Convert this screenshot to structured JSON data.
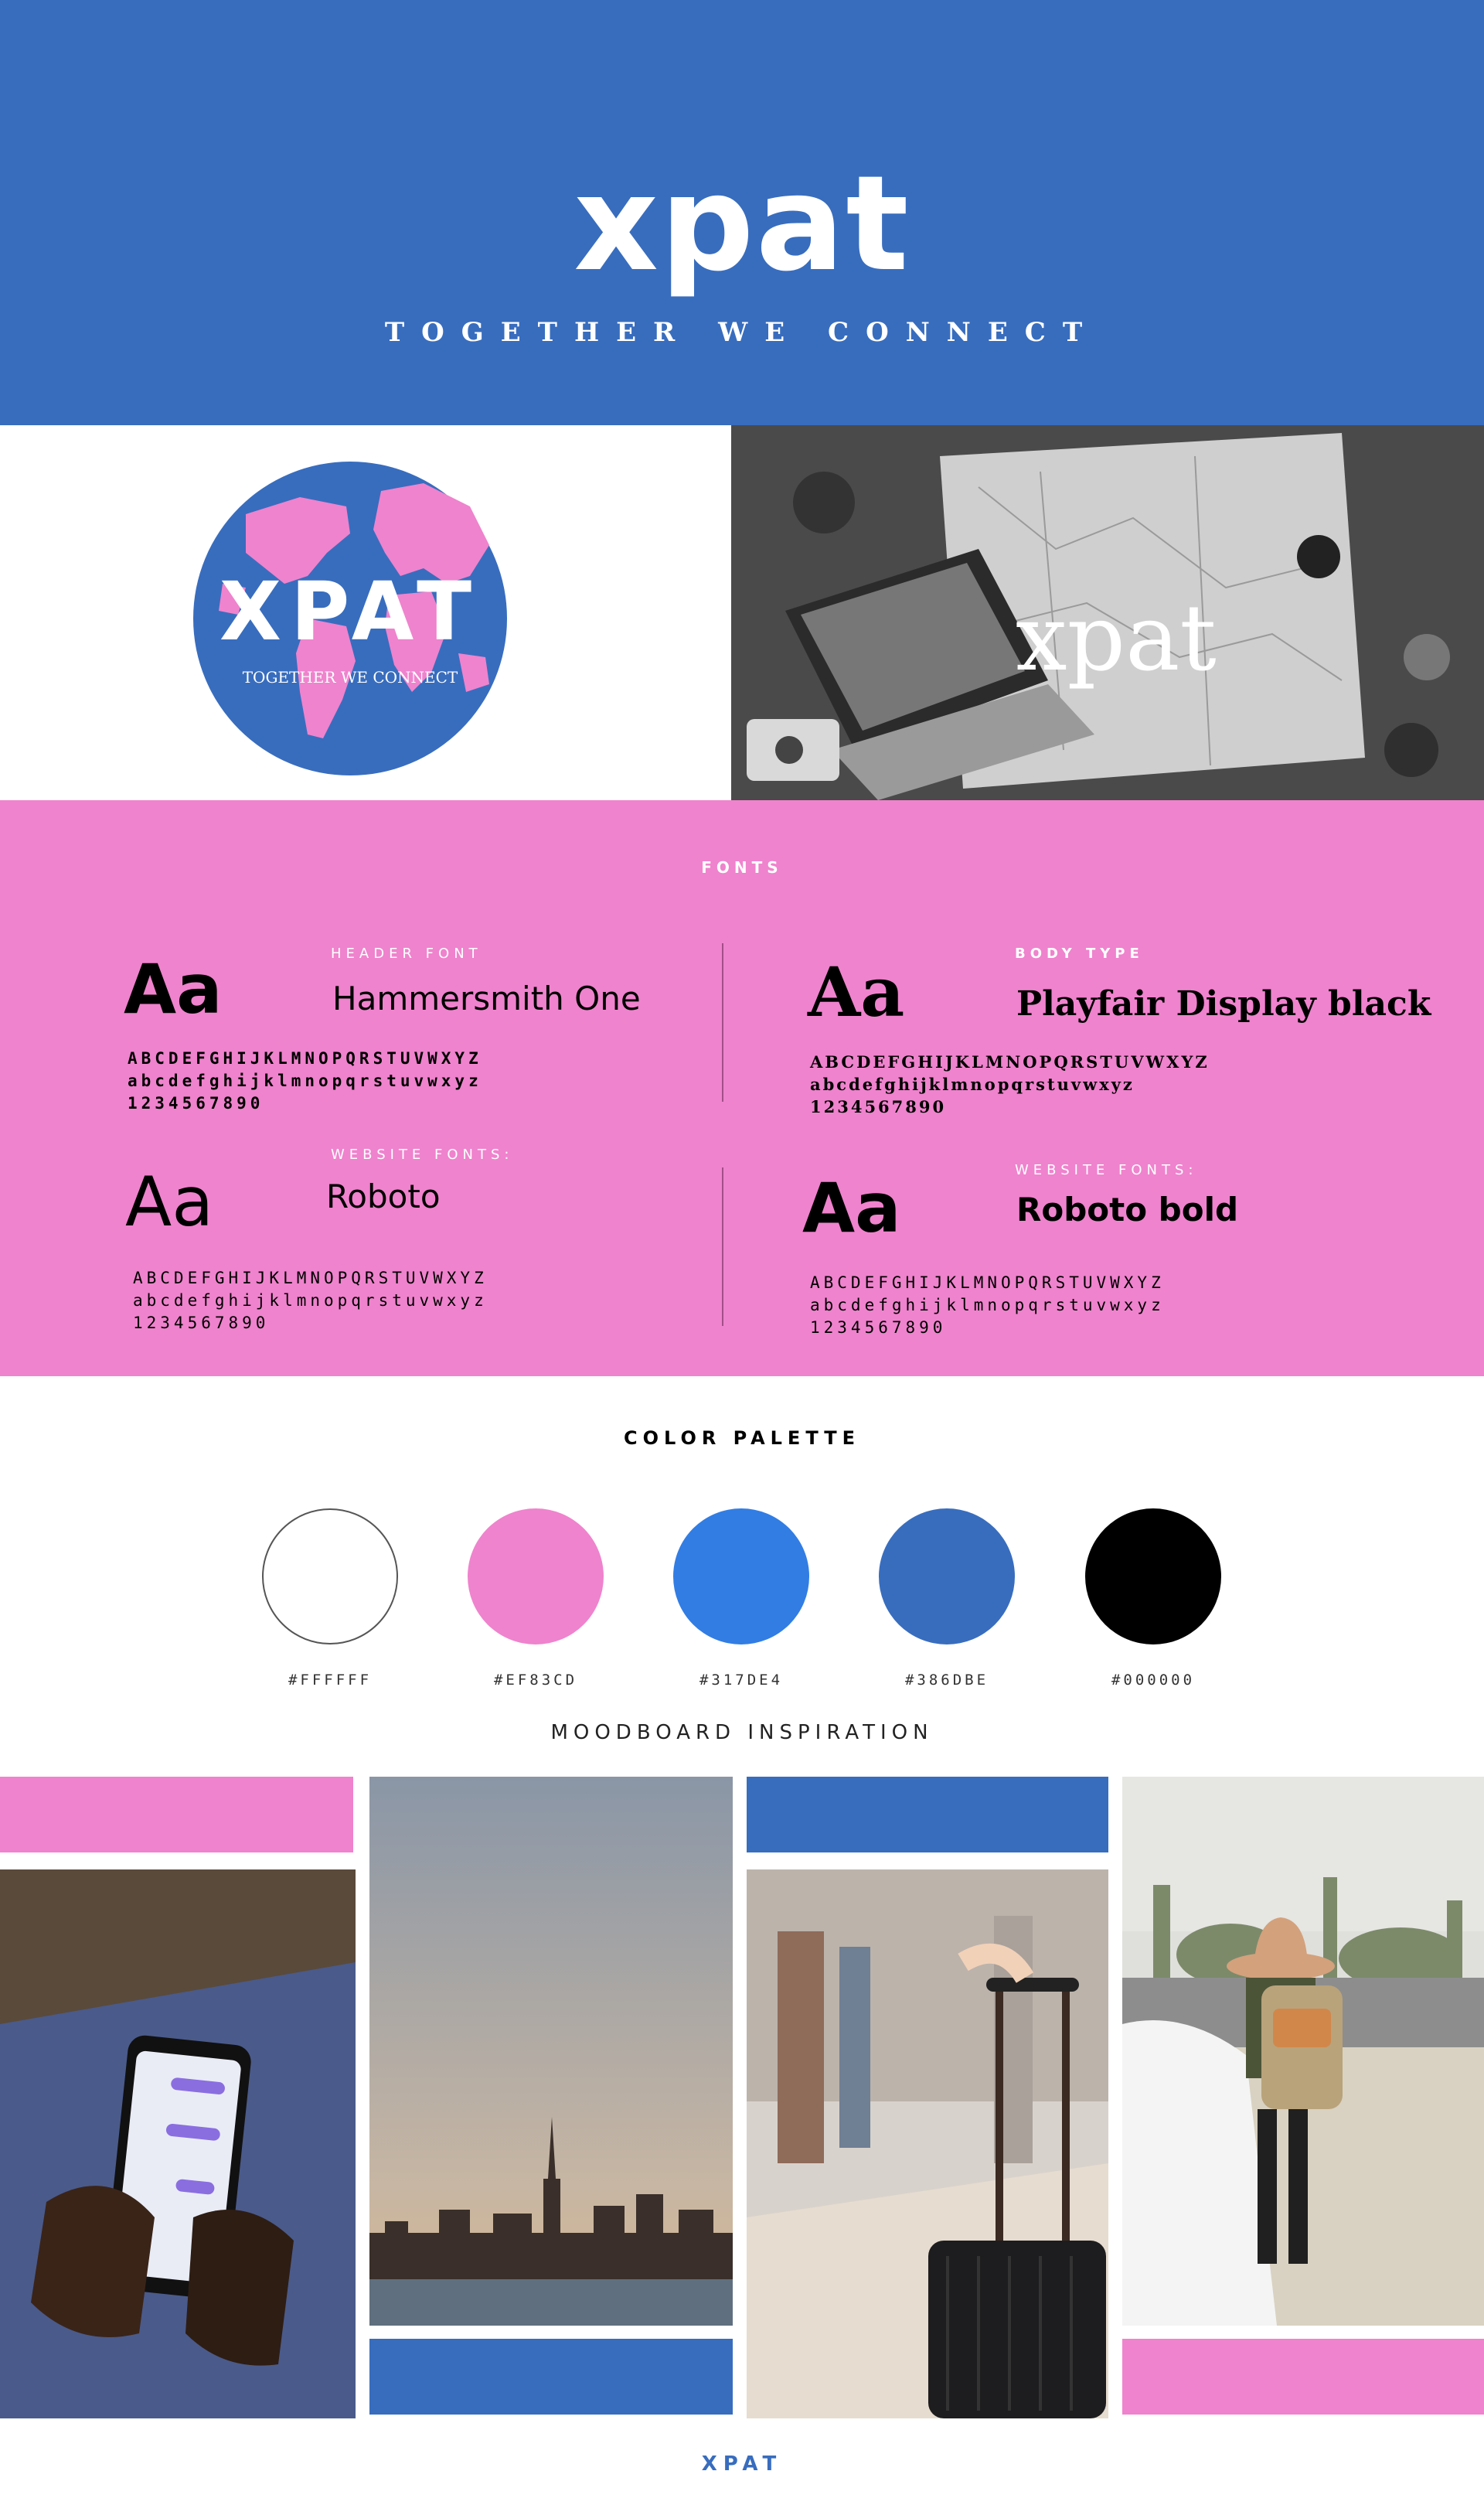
{
  "header": {
    "title": "xpat",
    "tagline": "TOGETHER WE CONNECT"
  },
  "logo": {
    "wordmark": "XPAT",
    "tagline": "TOGETHER WE CONNECT",
    "photo_wordmark": "xpat"
  },
  "fonts": {
    "section_title": "FONTS",
    "blocks": [
      {
        "label": "HEADER FONT",
        "sample": "Aa",
        "name": "Hammersmith One",
        "upper": "ABCDEFGHIJKLMNOPQRSTUVWXYZ",
        "lower": "abcdefghijklmnopqrstuvwxyz",
        "digits": "1234567890"
      },
      {
        "label": "BODY TYPE",
        "sample": "Aa",
        "name": "Playfair Display black",
        "upper": "ABCDEFGHIJKLMNOPQRSTUVWXYZ",
        "lower": "abcdefghijklmnopqrstuvwxyz",
        "digits": "1234567890"
      },
      {
        "label": "WEBSITE FONTS:",
        "sample": "Aa",
        "name": "Roboto",
        "upper": "ABCDEFGHIJKLMNOPQRSTUVWXYZ",
        "lower": "abcdefghijklmnopqrstuvwxyz",
        "digits": "1234567890"
      },
      {
        "label": "WEBSITE FONTS:",
        "sample": "Aa",
        "name": "Roboto bold",
        "upper": "ABCDEFGHIJKLMNOPQRSTUVWXYZ",
        "lower": "abcdefghijklmnopqrstuvwxyz",
        "digits": "1234567890"
      }
    ]
  },
  "palette": {
    "title": "COLOR PALETTE",
    "colors": [
      {
        "hex": "#FFFFFF",
        "value": "#FFFFFF"
      },
      {
        "hex": "#EF83CD",
        "value": "#EF83CD"
      },
      {
        "hex": "#317DE4",
        "value": "#317DE4"
      },
      {
        "hex": "#386DBE",
        "value": "#386DBE"
      },
      {
        "hex": "#000000",
        "value": "#000000"
      }
    ]
  },
  "moodboard": {
    "title": "MOODBOARD INSPIRATION"
  },
  "footer": {
    "brand": "XPAT"
  }
}
